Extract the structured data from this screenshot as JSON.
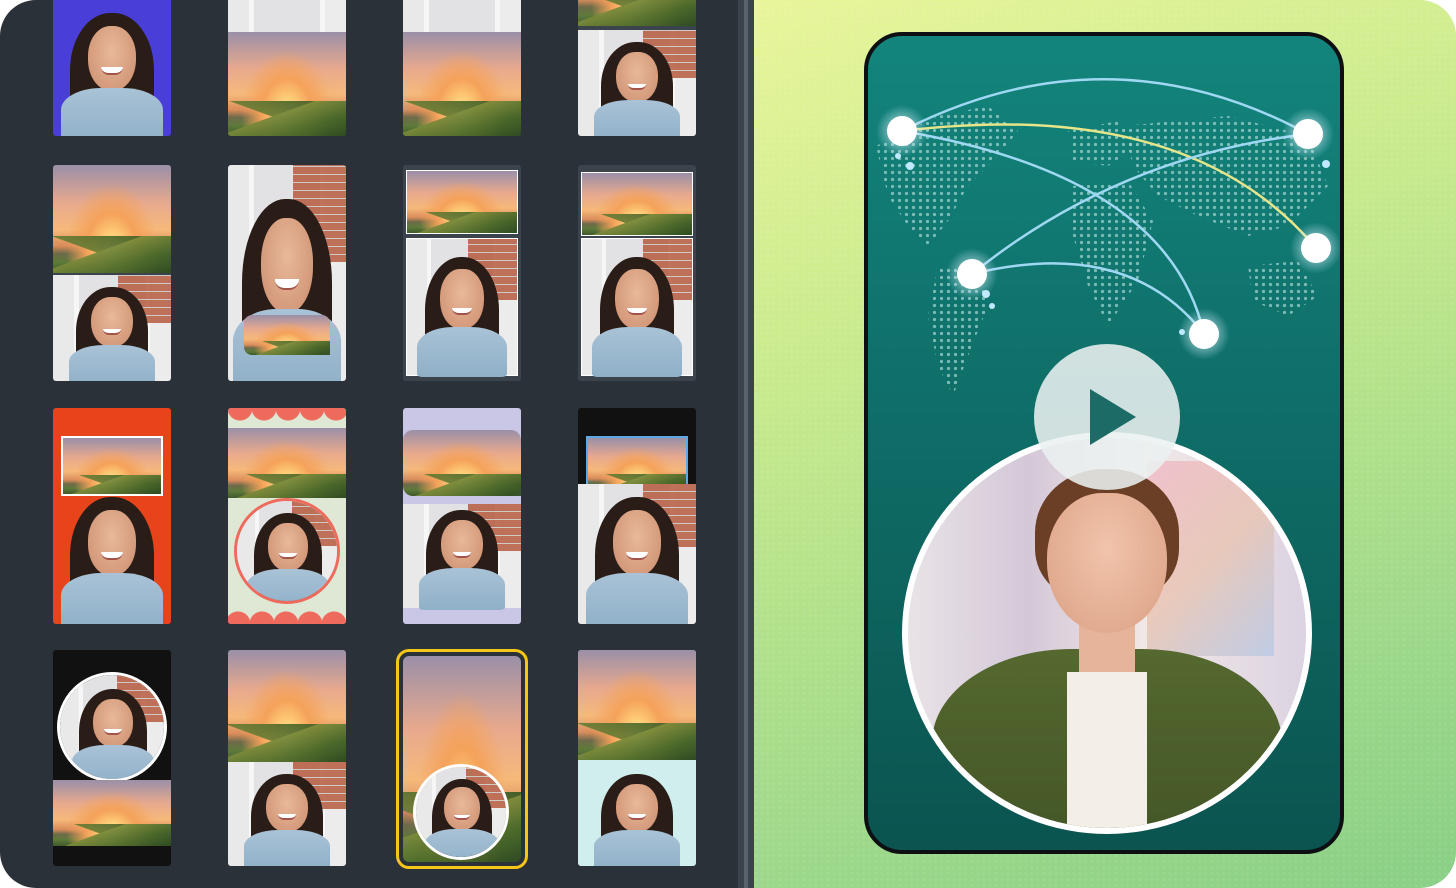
{
  "layout_gallery": {
    "tiles": [
      {
        "name": "layout-tile-1",
        "selected": false
      },
      {
        "name": "layout-tile-2",
        "selected": false
      },
      {
        "name": "layout-tile-3",
        "selected": false
      },
      {
        "name": "layout-tile-4",
        "selected": false
      },
      {
        "name": "layout-tile-5",
        "selected": false
      },
      {
        "name": "layout-tile-6",
        "selected": false
      },
      {
        "name": "layout-tile-7",
        "selected": false
      },
      {
        "name": "layout-tile-8",
        "selected": false
      },
      {
        "name": "layout-tile-9",
        "selected": false
      },
      {
        "name": "layout-tile-10",
        "selected": false
      },
      {
        "name": "layout-tile-11",
        "selected": false
      },
      {
        "name": "layout-tile-12",
        "selected": false
      },
      {
        "name": "layout-tile-13",
        "selected": false
      },
      {
        "name": "layout-tile-14",
        "selected": false
      },
      {
        "name": "layout-tile-15",
        "selected": true
      },
      {
        "name": "layout-tile-16",
        "selected": false
      }
    ],
    "selected_color": "#f5c518"
  },
  "preview": {
    "play_icon": "play-icon",
    "accent": "#13857c",
    "route_color": "#9fd8f2",
    "route_highlight_color": "#e6e58a"
  }
}
